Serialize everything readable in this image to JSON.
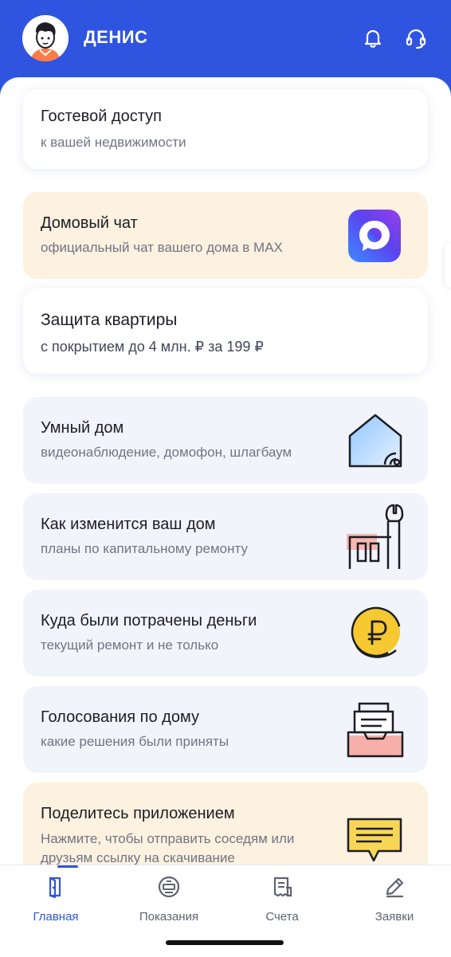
{
  "header": {
    "username": "ДЕНИС",
    "background_color": "#2f55e0",
    "icons": [
      "avatar-illustration",
      "bell-icon",
      "headset-icon"
    ]
  },
  "cards": [
    {
      "title": "Гостевой доступ",
      "subtitle": "к вашей недвижимости",
      "style": "white"
    },
    {
      "title": "Домовый чат",
      "subtitle": "официальный чат вашего дома в MAX",
      "style": "peach",
      "icon": "max-app-icon"
    },
    {
      "title": "Защита квартиры",
      "subtitle": "с покрытием до 4 млн. ₽ за 199 ₽",
      "style": "white"
    },
    {
      "title": "Умный дом",
      "subtitle": "видеонаблюдение, домофон, шлагбаум",
      "style": "blue",
      "icon": "smart-house-icon"
    },
    {
      "title": "Как изменится ваш дом",
      "subtitle": "планы по капитальному ремонту",
      "style": "blue",
      "icon": "wrench-building-icon"
    },
    {
      "title": "Куда были потрачены деньги",
      "subtitle": "текущий ремонт и не только",
      "style": "blue",
      "icon": "ruble-coin-icon"
    },
    {
      "title": "Голосования по дому",
      "subtitle": "какие решения были приняты",
      "style": "blue",
      "icon": "ballot-box-icon"
    },
    {
      "title": "Поделитесь приложением",
      "subtitle_line1": "Нажмите, чтобы отправить соседям или",
      "subtitle_line2": "друзьям ссылку на скачивание",
      "style": "peach",
      "icon": "message-bubble-icon"
    }
  ],
  "tabbar": {
    "tabs": [
      {
        "label": "Главная",
        "icon": "door-icon",
        "active": true
      },
      {
        "label": "Показания",
        "icon": "meter-icon",
        "active": false
      },
      {
        "label": "Счета",
        "icon": "receipt-icon",
        "active": false
      },
      {
        "label": "Заявки",
        "icon": "pencil-icon",
        "active": false
      }
    ]
  },
  "colors": {
    "accent": "#2f55e0",
    "peach_card": "#fdf1df",
    "blue_card": "#f2f4fb",
    "coin_yellow": "#f5c92f"
  }
}
